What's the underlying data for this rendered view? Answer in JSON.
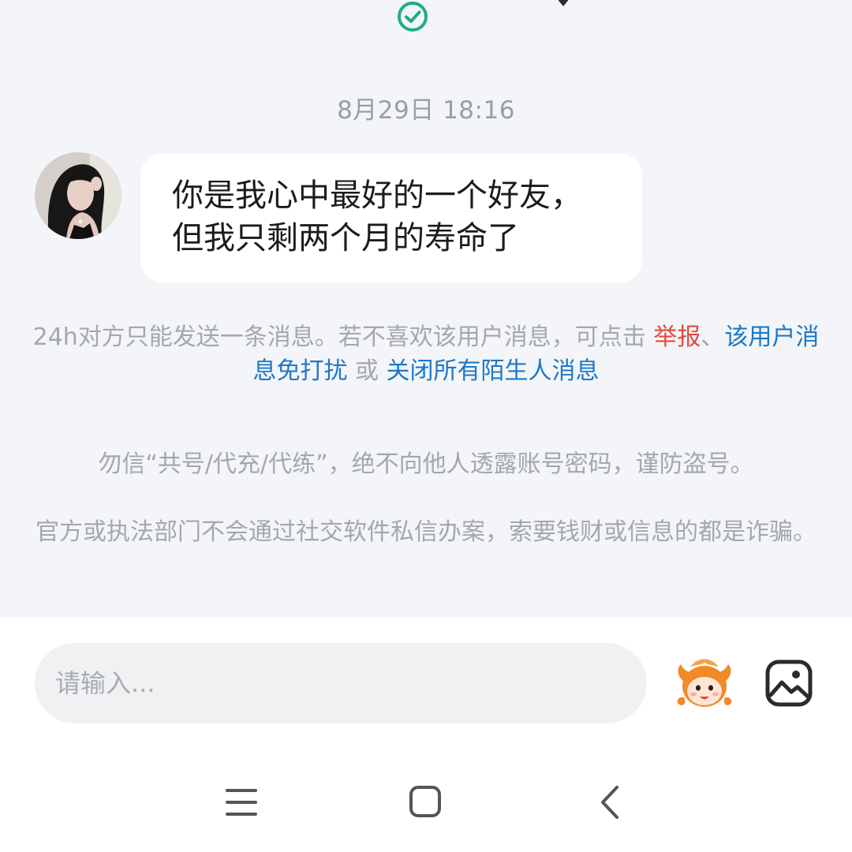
{
  "chat": {
    "timestamp": "8月29日 18:16",
    "message": {
      "line1": "你是我心中最好的一个好友，",
      "line2": "但我只剩两个月的寿命了"
    },
    "notice": {
      "text": "24h对方只能发送一条消息。若不喜欢该用户消息，可点击 ",
      "report_link": "举报",
      "separator": "、",
      "mute_link": "该用户消息免打扰",
      "or_text": " 或 ",
      "close_link": "关闭所有陌生人消息"
    },
    "warnings": {
      "line1": "勿信“共号/代充/代练”，绝不向他人透露账号密码，谨防盗号。",
      "line2": "官方或执法部门不会通过社交软件私信办案，索要钱财或信息的都是诈骗。"
    }
  },
  "input_bar": {
    "placeholder": "请输入..."
  },
  "icons": {
    "top_status": "check-circle-icon",
    "sticker": "cartoon-face-sticker-icon",
    "image": "image-icon",
    "nav_menu": "menu-icon",
    "nav_home": "home-square-icon",
    "nav_back": "back-chevron-icon"
  },
  "colors": {
    "background": "#f3f5f8",
    "bubble": "#ffffff",
    "check_green": "#1fae84",
    "link_red": "#e5483f",
    "link_blue": "#1d78c8",
    "muted_text": "#a4a8ad"
  }
}
